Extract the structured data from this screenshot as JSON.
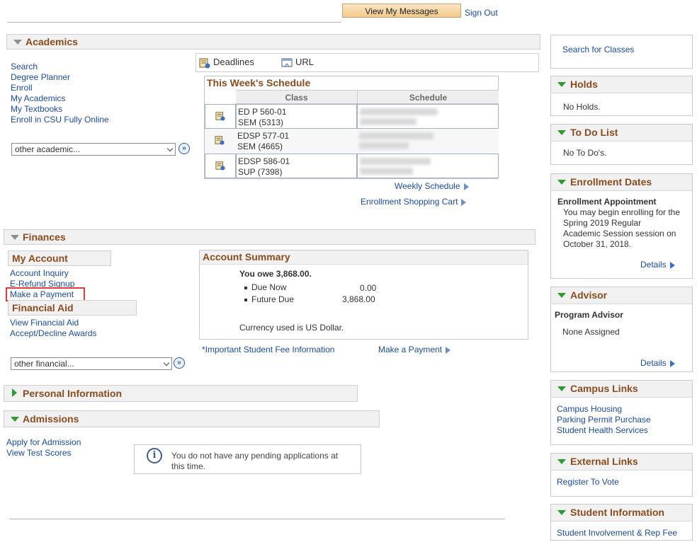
{
  "top": {
    "view_messages": "View My Messages",
    "sign_out": "Sign Out"
  },
  "academics": {
    "title": "Academics",
    "links": [
      "Search",
      "Degree Planner",
      "Enroll",
      "My Academics",
      "My Textbooks",
      "Enroll in CSU Fully Online"
    ],
    "dropdown": "other academic...",
    "tabs": {
      "deadlines": "Deadlines",
      "url": "URL"
    },
    "schedule": {
      "title": "This Week's Schedule",
      "headers": {
        "class": "Class",
        "schedule": "Schedule"
      },
      "rows": [
        {
          "line1": "ED P 560-01",
          "line2": "SEM (5313)"
        },
        {
          "line1": "EDSP 577-01",
          "line2": "SEM (4665)"
        },
        {
          "line1": "EDSP 586-01",
          "line2": "SUP (7398)"
        }
      ]
    },
    "weekly_schedule": "Weekly Schedule",
    "shopping_cart": "Enrollment Shopping Cart"
  },
  "finances": {
    "title": "Finances",
    "my_account": {
      "title": "My Account",
      "links": [
        "Account Inquiry",
        "E-Refund Signup",
        "Make a Payment"
      ]
    },
    "financial_aid": {
      "title": "Financial Aid",
      "links": [
        "View Financial Aid",
        "Accept/Decline Awards"
      ]
    },
    "dropdown": "other financial...",
    "summary": {
      "title": "Account Summary",
      "you_owe": "You owe 3,868.00.",
      "due_now_label": "Due Now",
      "due_now_value": "0.00",
      "future_due_label": "Future Due",
      "future_due_value": "3,868.00",
      "currency": "Currency used is US Dollar."
    },
    "fee_info": "*Important Student Fee Information",
    "make_payment": "Make a Payment"
  },
  "personal_info": {
    "title": "Personal Information"
  },
  "admissions": {
    "title": "Admissions",
    "links": [
      "Apply for Admission",
      "View Test Scores"
    ],
    "info_line1": "You do not have any pending applications at",
    "info_line2": "this time."
  },
  "right": {
    "search_classes": "Search for Classes",
    "holds": {
      "title": "Holds",
      "text": "No Holds."
    },
    "todo": {
      "title": "To Do List",
      "text": "No To Do's."
    },
    "enrollment_dates": {
      "title": "Enrollment Dates",
      "subtitle": "Enrollment Appointment",
      "lines": [
        "You may begin enrolling for the",
        "Spring 2019 Regular",
        "Academic Session session on",
        "October 31, 2018."
      ],
      "details": "Details"
    },
    "advisor": {
      "title": "Advisor",
      "subtitle": "Program Advisor",
      "text": "None Assigned",
      "details": "Details"
    },
    "campus_links": {
      "title": "Campus Links",
      "links": [
        "Campus Housing",
        "Parking Permit Purchase",
        "Student Health Services"
      ]
    },
    "external_links": {
      "title": "External Links",
      "links": [
        "Register To Vote"
      ]
    },
    "student_info": {
      "title": "Student Information",
      "links": [
        "Student Involvement & Rep Fee"
      ]
    }
  }
}
